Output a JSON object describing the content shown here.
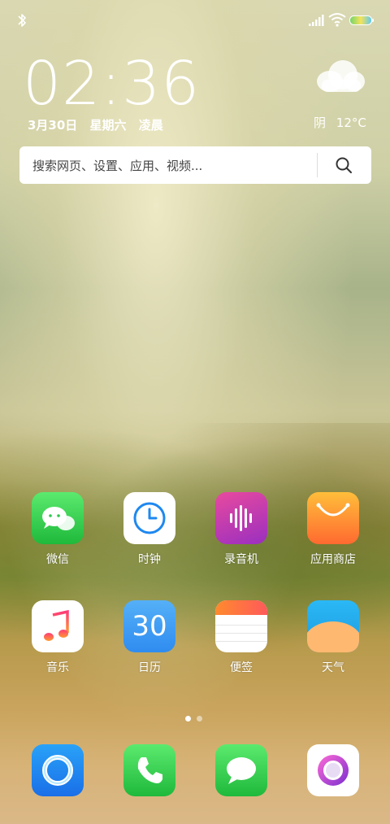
{
  "status_bar": {
    "icons": [
      "bluetooth-icon",
      "signal-icon",
      "wifi-icon",
      "battery-icon"
    ]
  },
  "clock": {
    "time": "02:36",
    "date": "3月30日",
    "weekday": "星期六",
    "period": "凌晨"
  },
  "weather": {
    "icon": "cloud-icon",
    "condition": "阴",
    "temperature": "12°C"
  },
  "search": {
    "placeholder": "搜索网页、设置、应用、视频..."
  },
  "apps": [
    {
      "label": "微信",
      "icon": "wechat-icon"
    },
    {
      "label": "时钟",
      "icon": "clock-icon"
    },
    {
      "label": "录音机",
      "icon": "recorder-icon"
    },
    {
      "label": "应用商店",
      "icon": "app-store-icon"
    },
    {
      "label": "音乐",
      "icon": "music-icon"
    },
    {
      "label": "日历",
      "icon": "calendar-icon",
      "text": "30"
    },
    {
      "label": "便签",
      "icon": "notes-icon"
    },
    {
      "label": "天气",
      "icon": "weather-icon"
    }
  ],
  "dock": [
    {
      "icon": "browser-icon"
    },
    {
      "icon": "phone-icon"
    },
    {
      "icon": "messages-icon"
    },
    {
      "icon": "camera-icon"
    }
  ],
  "pages": {
    "count": 2,
    "current": 1
  },
  "colors": {
    "wechat": "#2fc84e",
    "clock_accent": "#1e88f0",
    "recorder": "#c32fa0",
    "app_store": "#ff7a2e",
    "music": "#ff3b5c",
    "calendar": "#3b9cf5",
    "notes": "#ffa726",
    "weather": "#2ba8ef",
    "browser": "#2081f0",
    "phone": "#30c94e",
    "messages": "#30c94e",
    "camera": "#a92fc9"
  }
}
